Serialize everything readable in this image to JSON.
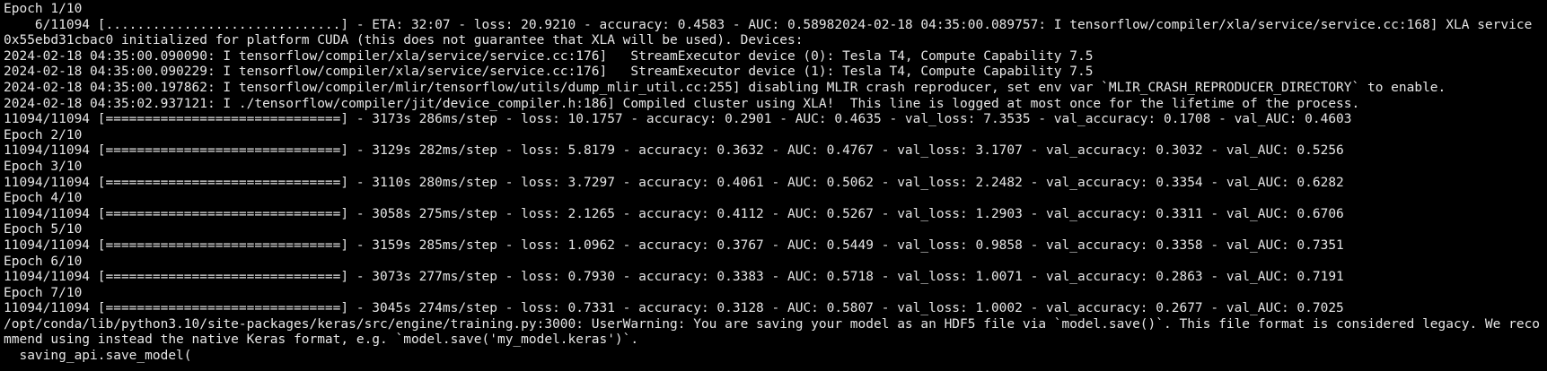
{
  "terminal": {
    "lines": [
      "Epoch 1/10",
      "    6/11094 [..............................] - ETA: 32:07 - loss: 20.9210 - accuracy: 0.4583 - AUC: 0.58982024-02-18 04:35:00.089757: I tensorflow/compiler/xla/service/service.cc:168] XLA service",
      "0x55ebd31cbac0 initialized for platform CUDA (this does not guarantee that XLA will be used). Devices:",
      "2024-02-18 04:35:00.090090: I tensorflow/compiler/xla/service/service.cc:176]   StreamExecutor device (0): Tesla T4, Compute Capability 7.5",
      "2024-02-18 04:35:00.090229: I tensorflow/compiler/xla/service/service.cc:176]   StreamExecutor device (1): Tesla T4, Compute Capability 7.5",
      "2024-02-18 04:35:00.197862: I tensorflow/compiler/mlir/tensorflow/utils/dump_mlir_util.cc:255] disabling MLIR crash reproducer, set env var `MLIR_CRASH_REPRODUCER_DIRECTORY` to enable.",
      "2024-02-18 04:35:02.937121: I ./tensorflow/compiler/jit/device_compiler.h:186] Compiled cluster using XLA!  This line is logged at most once for the lifetime of the process.",
      "11094/11094 [==============================] - 3173s 286ms/step - loss: 10.1757 - accuracy: 0.2901 - AUC: 0.4635 - val_loss: 7.3535 - val_accuracy: 0.1708 - val_AUC: 0.4603",
      "Epoch 2/10",
      "11094/11094 [==============================] - 3129s 282ms/step - loss: 5.8179 - accuracy: 0.3632 - AUC: 0.4767 - val_loss: 3.1707 - val_accuracy: 0.3032 - val_AUC: 0.5256",
      "Epoch 3/10",
      "11094/11094 [==============================] - 3110s 280ms/step - loss: 3.7297 - accuracy: 0.4061 - AUC: 0.5062 - val_loss: 2.2482 - val_accuracy: 0.3354 - val_AUC: 0.6282",
      "Epoch 4/10",
      "11094/11094 [==============================] - 3058s 275ms/step - loss: 2.1265 - accuracy: 0.4112 - AUC: 0.5267 - val_loss: 1.2903 - val_accuracy: 0.3311 - val_AUC: 0.6706",
      "Epoch 5/10",
      "11094/11094 [==============================] - 3159s 285ms/step - loss: 1.0962 - accuracy: 0.3767 - AUC: 0.5449 - val_loss: 0.9858 - val_accuracy: 0.3358 - val_AUC: 0.7351",
      "Epoch 6/10",
      "11094/11094 [==============================] - 3073s 277ms/step - loss: 0.7930 - accuracy: 0.3383 - AUC: 0.5718 - val_loss: 1.0071 - val_accuracy: 0.2863 - val_AUC: 0.7191",
      "Epoch 7/10",
      "11094/11094 [==============================] - 3045s 274ms/step - loss: 0.7331 - accuracy: 0.3128 - AUC: 0.5807 - val_loss: 1.0002 - val_accuracy: 0.2677 - val_AUC: 0.7025",
      "/opt/conda/lib/python3.10/site-packages/keras/src/engine/training.py:3000: UserWarning: You are saving your model as an HDF5 file via `model.save()`. This file format is considered legacy. We reco",
      "mmend using instead the native Keras format, e.g. `model.save('my_model.keras')`.",
      "  saving_api.save_model("
    ],
    "colors": {
      "background": "#000000",
      "foreground": "#e6e6e6"
    }
  }
}
